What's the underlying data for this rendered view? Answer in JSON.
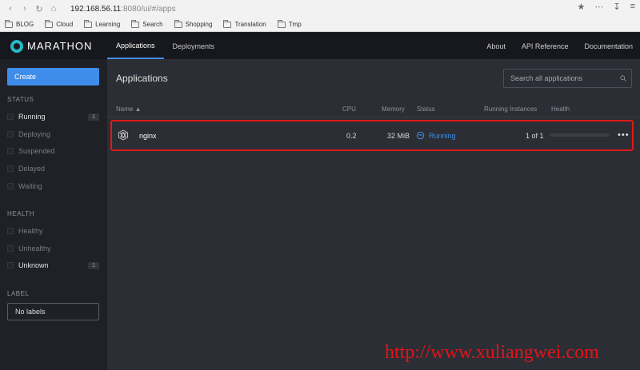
{
  "browser": {
    "url_host": "192.168.56.11",
    "url_rest": ":8080/ui/#/apps",
    "bookmarks": [
      "BLOG",
      "Cloud",
      "Learning",
      "Search",
      "Shopping",
      "Translation",
      "Tmp"
    ]
  },
  "header": {
    "logo_text": "MARATHON",
    "tabs": [
      {
        "label": "Applications",
        "active": true
      },
      {
        "label": "Deployments",
        "active": false
      }
    ],
    "right_links": [
      "About",
      "API Reference",
      "Documentation"
    ]
  },
  "sidebar": {
    "create_label": "Create",
    "status_title": "STATUS",
    "status_filters": [
      {
        "label": "Running",
        "count": "1"
      },
      {
        "label": "Deploying"
      },
      {
        "label": "Suspended"
      },
      {
        "label": "Delayed"
      },
      {
        "label": "Waiting"
      }
    ],
    "health_title": "HEALTH",
    "health_filters": [
      {
        "label": "Healthy"
      },
      {
        "label": "Unhealthy"
      },
      {
        "label": "Unknown",
        "count": "1"
      }
    ],
    "label_title": "LABEL",
    "label_select": "No labels"
  },
  "main": {
    "title": "Applications",
    "search_placeholder": "Search all applications",
    "columns": {
      "name": "Name ▲",
      "cpu": "CPU",
      "memory": "Memory",
      "status": "Status",
      "instances": "Running Instances",
      "health": "Health"
    },
    "rows": [
      {
        "name": "nginx",
        "cpu": "0.2",
        "memory": "32 MiB",
        "status": "Running",
        "instances": "1 of 1"
      }
    ]
  },
  "colors": {
    "accent": "#3f8dea",
    "highlight": "#e01818",
    "watermark": "#e3141b"
  },
  "watermark": "http://www.xuliangwei.com"
}
